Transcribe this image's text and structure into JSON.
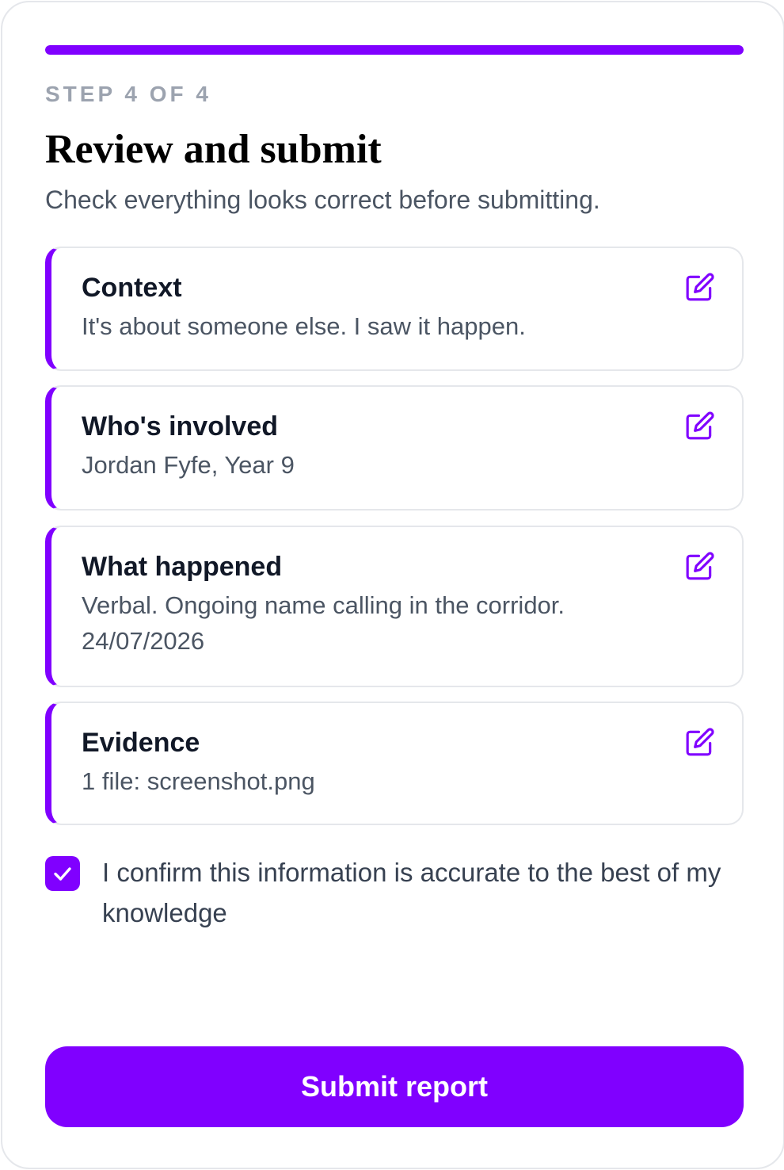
{
  "progress": {
    "fraction": 1.0,
    "step_label": "STEP 4 OF 4"
  },
  "header": {
    "title": "Review and submit",
    "subtitle": "Check everything looks correct before submitting."
  },
  "sections": [
    {
      "title": "Context",
      "value": "It's about someone else. I saw it happen.",
      "edit_icon": "pencil-square-icon"
    },
    {
      "title": "Who's involved",
      "value": "Jordan Fyfe, Year 9",
      "edit_icon": "pencil-square-icon"
    },
    {
      "title": "What happened",
      "value": "Verbal. Ongoing name calling in the corridor.",
      "date": "24/07/2026",
      "edit_icon": "pencil-square-icon"
    },
    {
      "title": "Evidence",
      "value": "1 file: screenshot.png",
      "edit_icon": "pencil-square-icon"
    }
  ],
  "confirm": {
    "checked": true,
    "label": "I confirm this information is accurate to the best of my knowledge"
  },
  "submit": {
    "label": "Submit report"
  },
  "colors": {
    "accent": "#8000ff",
    "border": "#e5e7eb",
    "muted": "#9ca3af",
    "body_text": "#4b5563",
    "heading": "#111827"
  }
}
